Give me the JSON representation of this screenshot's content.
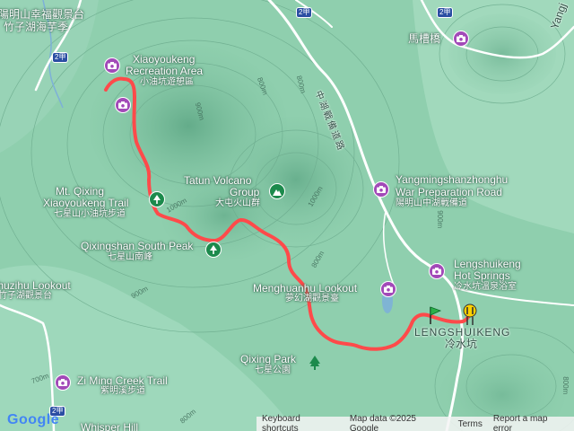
{
  "map": {
    "colors": {
      "terrain": "#8fcfae",
      "route": "#ff4a4a",
      "poi": "#a24ab8",
      "park": "#1c8a4c",
      "road": "#ffffff",
      "shield": "#2b4ea3"
    },
    "places": {
      "top_left_zh_1": "陽明山幸福觀景台",
      "top_left_zh_2": "竹子湖海芋季",
      "xiaoyoukeng_area_en_1": "Xiaoyoukeng",
      "xiaoyoukeng_area_en_2": "Recreation Area",
      "xiaoyoukeng_area_zh": "小油坑遊憩區",
      "qixing_trail_en_1": "Mt. Qixing",
      "qixing_trail_en_2": "Xiaoyoukeng Trail",
      "qixing_trail_zh": "七星山小油坑步道",
      "tatun_en_1": "Tatun Volcano",
      "tatun_en_2": "Group",
      "tatun_zh": "大屯火山群",
      "qixing_south_en": "Qixingshan South Peak",
      "qixing_south_zh": "七星山南峰",
      "zhuzihu_en": "Zhuzihu Lookout",
      "zhuzihu_zh": "竹子湖觀景台",
      "menghuanhu_en": "Menghuanhu Lookout",
      "menghuanhu_zh": "夢幻湖觀景臺",
      "zhongxinghu_war_en_1": "Yangmingshanzhonghu",
      "zhongxinghu_war_en_2": "War Preparation Road",
      "zhongxinghu_war_zh": "陽明山中湖戰備道",
      "lengshuikeng_hs_en_1": "Lengshuikeng",
      "lengshuikeng_hs_en_2": "Hot Springs",
      "lengshuikeng_hs_zh": "冷水坑溫泉浴室",
      "lengshuikeng_en": "LENGSHUIKENG",
      "lengshuikeng_zh": "冷水坑",
      "qixing_park_en": "Qixing Park",
      "qixing_park_zh": "七星公園",
      "ziming_en": "Zi Ming Creek Trail",
      "ziming_zh": "紫明溪步道",
      "macao_bridge_zh": "馬槽橋",
      "road_zh": "中湖戰備道路",
      "bottom_partial": "Whisper Hill",
      "right_partial": "Yangj"
    },
    "contours": [
      "800m",
      "900m",
      "1000m",
      "900m",
      "800m",
      "800m",
      "900m",
      "1000m",
      "800m",
      "700m",
      "800m"
    ],
    "shields": [
      "2甲",
      "2甲",
      "2甲",
      "2甲"
    ],
    "footer": {
      "google": "Google",
      "keyboard": "Keyboard shortcuts",
      "mapdata": "Map data ©2025 Google",
      "terms": "Terms",
      "report": "Report a map error"
    }
  }
}
